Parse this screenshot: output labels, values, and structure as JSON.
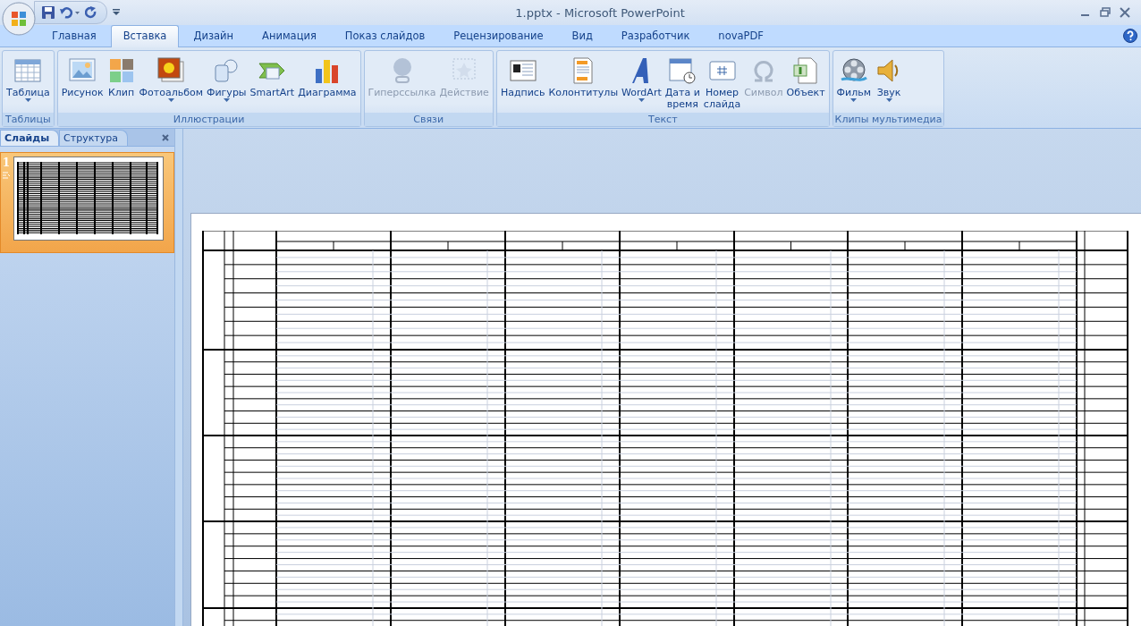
{
  "window": {
    "title": "1.pptx - Microsoft PowerPoint"
  },
  "tabs": [
    {
      "label": "Главная",
      "selected": false
    },
    {
      "label": "Вставка",
      "selected": true
    },
    {
      "label": "Дизайн",
      "selected": false
    },
    {
      "label": "Анимация",
      "selected": false
    },
    {
      "label": "Показ слайдов",
      "selected": false
    },
    {
      "label": "Рецензирование",
      "selected": false
    },
    {
      "label": "Вид",
      "selected": false
    },
    {
      "label": "Разработчик",
      "selected": false
    },
    {
      "label": "novaPDF",
      "selected": false
    }
  ],
  "ribbon_groups": [
    {
      "title": "Таблицы",
      "buttons": [
        {
          "label": "Таблица",
          "disabled": false,
          "dropdown": true
        }
      ]
    },
    {
      "title": "Иллюстрации",
      "buttons": [
        {
          "label": "Рисунок",
          "disabled": false,
          "dropdown": false
        },
        {
          "label": "Клип",
          "disabled": false,
          "dropdown": false
        },
        {
          "label": "Фотоальбом",
          "disabled": false,
          "dropdown": true
        },
        {
          "label": "Фигуры",
          "disabled": false,
          "dropdown": true
        },
        {
          "label": "SmartArt",
          "disabled": false,
          "dropdown": false
        },
        {
          "label": "Диаграмма",
          "disabled": false,
          "dropdown": false
        }
      ]
    },
    {
      "title": "Связи",
      "buttons": [
        {
          "label": "Гиперссылка",
          "disabled": true,
          "dropdown": false
        },
        {
          "label": "Действие",
          "disabled": true,
          "dropdown": false
        }
      ]
    },
    {
      "title": "Текст",
      "buttons": [
        {
          "label": "Надпись",
          "disabled": false,
          "dropdown": false
        },
        {
          "label": "Колонтитулы",
          "disabled": false,
          "dropdown": false
        },
        {
          "label": "WordArt",
          "disabled": false,
          "dropdown": true
        },
        {
          "label": "Дата и\nвремя",
          "disabled": false,
          "dropdown": false
        },
        {
          "label": "Номер\nслайда",
          "disabled": false,
          "dropdown": false
        },
        {
          "label": "Символ",
          "disabled": true,
          "dropdown": false
        },
        {
          "label": "Объект",
          "disabled": false,
          "dropdown": false
        }
      ]
    },
    {
      "title": "Клипы мультимедиа",
      "buttons": [
        {
          "label": "Фильм",
          "disabled": false,
          "dropdown": true
        },
        {
          "label": "Звук",
          "disabled": false,
          "dropdown": true
        }
      ]
    }
  ],
  "pane_tabs": [
    {
      "label": "Слайды",
      "selected": true
    },
    {
      "label": "Структура",
      "selected": false
    }
  ],
  "slides": [
    {
      "number": "1",
      "selected": true
    }
  ]
}
